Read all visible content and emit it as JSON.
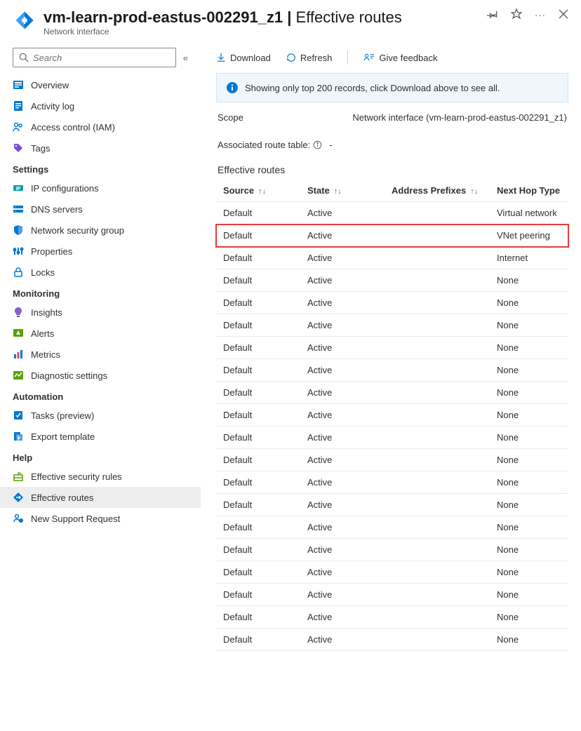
{
  "header": {
    "title_prefix": "vm-learn-prod-eastus-002291_z1",
    "title_sep": " | ",
    "title_suffix": "Effective routes",
    "subtitle": "Network interface"
  },
  "sidebar": {
    "search_placeholder": "Search",
    "top_items": [
      {
        "label": "Overview",
        "icon": "overview"
      },
      {
        "label": "Activity log",
        "icon": "activitylog"
      },
      {
        "label": "Access control (IAM)",
        "icon": "iam"
      },
      {
        "label": "Tags",
        "icon": "tags"
      }
    ],
    "groups": [
      {
        "title": "Settings",
        "items": [
          {
            "label": "IP configurations",
            "icon": "ipconfig"
          },
          {
            "label": "DNS servers",
            "icon": "dns"
          },
          {
            "label": "Network security group",
            "icon": "shield"
          },
          {
            "label": "Properties",
            "icon": "properties"
          },
          {
            "label": "Locks",
            "icon": "lock"
          }
        ]
      },
      {
        "title": "Monitoring",
        "items": [
          {
            "label": "Insights",
            "icon": "bulb"
          },
          {
            "label": "Alerts",
            "icon": "alert"
          },
          {
            "label": "Metrics",
            "icon": "metrics"
          },
          {
            "label": "Diagnostic settings",
            "icon": "diag"
          }
        ]
      },
      {
        "title": "Automation",
        "items": [
          {
            "label": "Tasks (preview)",
            "icon": "tasks"
          },
          {
            "label": "Export template",
            "icon": "export"
          }
        ]
      },
      {
        "title": "Help",
        "items": [
          {
            "label": "Effective security rules",
            "icon": "secrules"
          },
          {
            "label": "Effective routes",
            "icon": "routes",
            "active": true
          },
          {
            "label": "New Support Request",
            "icon": "support"
          }
        ]
      }
    ]
  },
  "toolbar": {
    "download": "Download",
    "refresh": "Refresh",
    "feedback": "Give feedback"
  },
  "info_message": "Showing only top 200 records, click Download above to see all.",
  "scope": {
    "label": "Scope",
    "value": "Network interface (vm-learn-prod-eastus-002291_z1)"
  },
  "assoc": {
    "label": "Associated route table:",
    "value": "-"
  },
  "table": {
    "title": "Effective routes",
    "headers": {
      "source": "Source",
      "state": "State",
      "prefixes": "Address Prefixes",
      "hop": "Next Hop Type"
    },
    "rows": [
      {
        "source": "Default",
        "state": "Active",
        "prefixes": "",
        "hop": "Virtual network"
      },
      {
        "source": "Default",
        "state": "Active",
        "prefixes": "",
        "hop": "VNet peering",
        "highlight": true
      },
      {
        "source": "Default",
        "state": "Active",
        "prefixes": "",
        "hop": "Internet"
      },
      {
        "source": "Default",
        "state": "Active",
        "prefixes": "",
        "hop": "None"
      },
      {
        "source": "Default",
        "state": "Active",
        "prefixes": "",
        "hop": "None"
      },
      {
        "source": "Default",
        "state": "Active",
        "prefixes": "",
        "hop": "None"
      },
      {
        "source": "Default",
        "state": "Active",
        "prefixes": "",
        "hop": "None"
      },
      {
        "source": "Default",
        "state": "Active",
        "prefixes": "",
        "hop": "None"
      },
      {
        "source": "Default",
        "state": "Active",
        "prefixes": "",
        "hop": "None"
      },
      {
        "source": "Default",
        "state": "Active",
        "prefixes": "",
        "hop": "None"
      },
      {
        "source": "Default",
        "state": "Active",
        "prefixes": "",
        "hop": "None"
      },
      {
        "source": "Default",
        "state": "Active",
        "prefixes": "",
        "hop": "None"
      },
      {
        "source": "Default",
        "state": "Active",
        "prefixes": "",
        "hop": "None"
      },
      {
        "source": "Default",
        "state": "Active",
        "prefixes": "",
        "hop": "None"
      },
      {
        "source": "Default",
        "state": "Active",
        "prefixes": "",
        "hop": "None"
      },
      {
        "source": "Default",
        "state": "Active",
        "prefixes": "",
        "hop": "None"
      },
      {
        "source": "Default",
        "state": "Active",
        "prefixes": "",
        "hop": "None"
      },
      {
        "source": "Default",
        "state": "Active",
        "prefixes": "",
        "hop": "None"
      },
      {
        "source": "Default",
        "state": "Active",
        "prefixes": "",
        "hop": "None"
      },
      {
        "source": "Default",
        "state": "Active",
        "prefixes": "",
        "hop": "None"
      }
    ]
  }
}
